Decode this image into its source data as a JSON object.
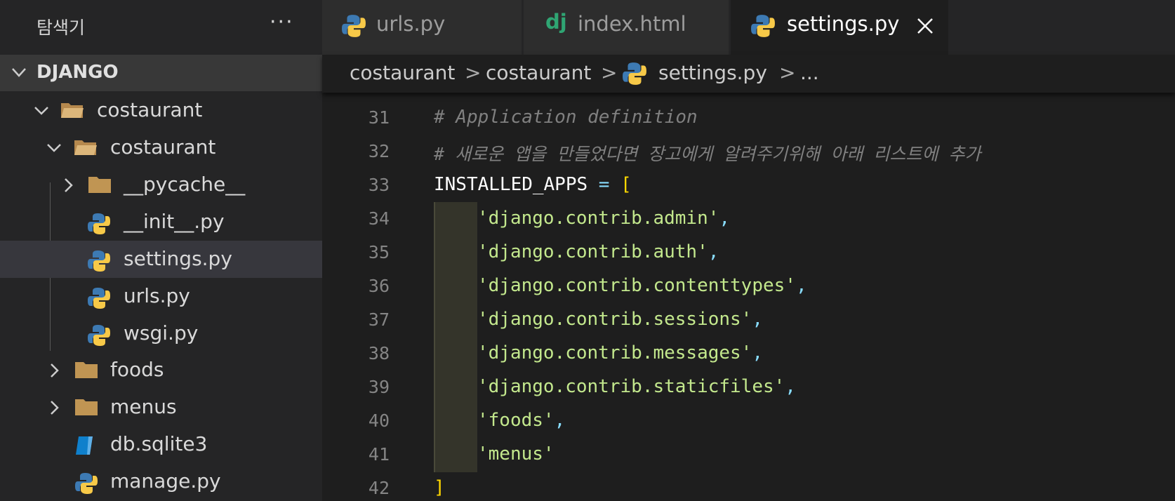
{
  "sidebar": {
    "title": "탐색기",
    "more": "···",
    "section": "DJANGO",
    "items": [
      {
        "label": "costaurant",
        "kind": "folder-open"
      },
      {
        "label": "costaurant",
        "kind": "folder-open"
      },
      {
        "label": "__pycache__",
        "kind": "folder"
      },
      {
        "label": "__init__.py",
        "kind": "python"
      },
      {
        "label": "settings.py",
        "kind": "python",
        "active": true
      },
      {
        "label": "urls.py",
        "kind": "python"
      },
      {
        "label": "wsgi.py",
        "kind": "python"
      },
      {
        "label": "foods",
        "kind": "folder"
      },
      {
        "label": "menus",
        "kind": "folder"
      },
      {
        "label": "db.sqlite3",
        "kind": "database"
      },
      {
        "label": "manage.py",
        "kind": "python"
      }
    ]
  },
  "tabs": [
    {
      "label": "urls.py",
      "icon": "python-icon"
    },
    {
      "label": "index.html",
      "icon": "django-icon",
      "icon_text": "dj"
    },
    {
      "label": "settings.py",
      "icon": "python-icon",
      "active": true
    }
  ],
  "breadcrumb": [
    "costaurant",
    "costaurant",
    "settings.py",
    "..."
  ],
  "breadcrumb_sep": ">",
  "editor": {
    "line_numbers": [
      "31",
      "32",
      "33",
      "34",
      "35",
      "36",
      "37",
      "38",
      "39",
      "40",
      "41",
      "42"
    ],
    "lines": {
      "l31": "# Application definition",
      "l32": "# 새로운 앱을 만들었다면 장고에게 알려주기위해 아래 리스트에 추가",
      "l33_var": "INSTALLED_APPS",
      "l33_eq": " = ",
      "l33_br": "[",
      "apps": [
        "'django.contrib.admin'",
        "'django.contrib.auth'",
        "'django.contrib.contenttypes'",
        "'django.contrib.sessions'",
        "'django.contrib.messages'",
        "'django.contrib.staticfiles'",
        "'foods'",
        "'menus'"
      ],
      "comma": ",",
      "l42": "]"
    }
  },
  "colors": {
    "editor_bg": "#1e1e1e",
    "sidebar_bg": "#252526",
    "string": "#c3e88d",
    "bracket": "#ffd700",
    "comment": "#808080"
  }
}
